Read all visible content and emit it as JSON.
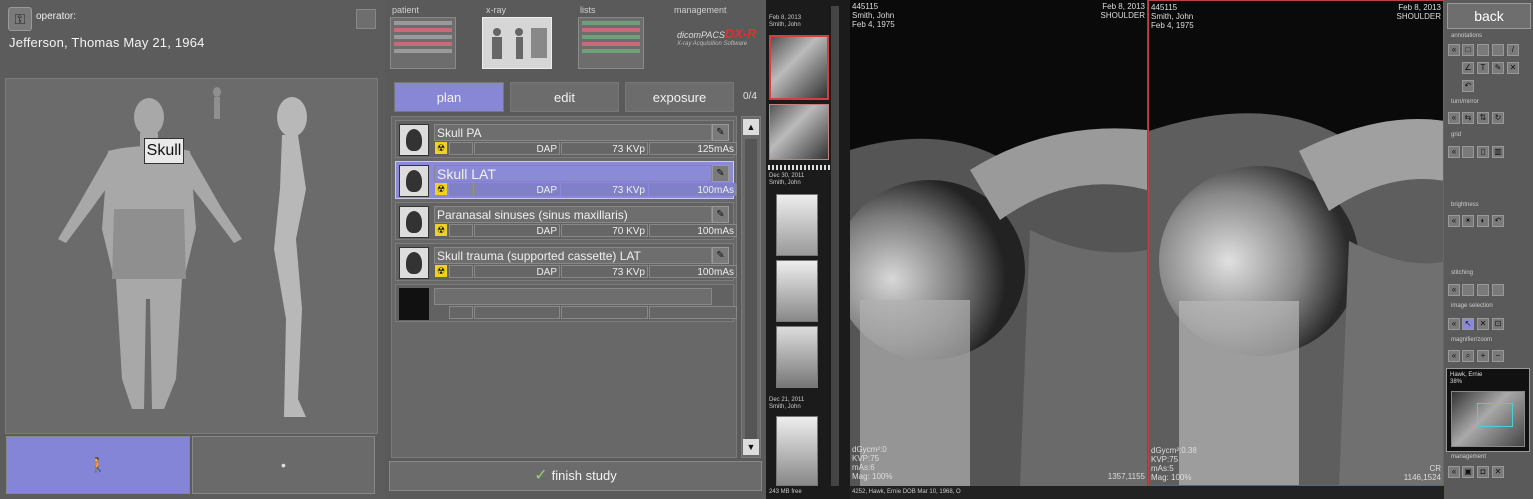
{
  "operator": {
    "label": "operator:",
    "key_icon": "key-icon"
  },
  "patient": {
    "name": "Jefferson,  Thomas  May 21, 1964"
  },
  "body_map": {
    "selected_region": "Skull"
  },
  "header_tabs": [
    {
      "label": "patient"
    },
    {
      "label": "x-ray"
    },
    {
      "label": "lists"
    },
    {
      "label": "management"
    }
  ],
  "brand": {
    "prefix": "dicomPACS",
    "suffix": "DX-R",
    "tagline": "X-ray Acquisition Software"
  },
  "mode_tabs": {
    "plan": "plan",
    "edit": "edit",
    "exposure": "exposure"
  },
  "exam_count": "0/4",
  "exams": [
    {
      "name": "Skull PA",
      "dap": "DAP",
      "kvp": "73 KVp",
      "mas": "125mAs",
      "selected": false
    },
    {
      "name": "Skull LAT",
      "dap": "DAP",
      "kvp": "73 KVp",
      "mas": "100mAs",
      "selected": true
    },
    {
      "name": "Paranasal sinuses (sinus maxillaris)",
      "dap": "DAP",
      "kvp": "70 KVp",
      "mas": "100mAs",
      "selected": false
    },
    {
      "name": "Skull trauma (supported cassette) LAT",
      "dap": "DAP",
      "kvp": "73 KVp",
      "mas": "100mAs",
      "selected": false
    }
  ],
  "finish_label": "finish study",
  "strip": {
    "s1_date": "Feb 8, 2013",
    "s1_name": "Smith, John",
    "s2_date": "Dec 30, 2011",
    "s2_name": "Smith, John",
    "s3_date": "Dec 21, 2011",
    "s3_name": "Smith, John",
    "footer": "243 MB free"
  },
  "viewer1": {
    "id": "445115",
    "name": "Smith, John",
    "dob": "Feb 4, 1975",
    "date": "Feb 8, 2013",
    "region": "SHOULDER",
    "dgy": "dGycm²:0",
    "kvp": "KVP:75",
    "mas": "mAs:6",
    "mag": "Mag: 100%",
    "size": "1357,1155"
  },
  "viewer2": {
    "id": "445115",
    "name": "Smith, John",
    "dob": "Feb 4, 1975",
    "date": "Feb 8, 2013",
    "region": "SHOULDER",
    "dgy": "dGycm²:0.38",
    "kvp": "KVP:75",
    "mas": "mAs:5",
    "mag": "Mag: 100%",
    "cr": "CR",
    "size": "1146,1524"
  },
  "bottom_bar": "4252, Hawk, Ernie DOB Mar 10, 1968, O",
  "tools": {
    "back": "back",
    "annotations": "annotations",
    "turn_mirror": "turn/mirror",
    "grid": "grid",
    "brightness": "brightness",
    "stitching": "stitching",
    "image_selection": "image selection",
    "magnifier": "magnifier/zoom",
    "minimap_name": "Hawk, Ernie",
    "minimap_zoom": "38%",
    "management": "management"
  },
  "colors": {
    "accent": "#8787d6",
    "panel": "#5a5a5a",
    "radiation": "#f0d020"
  }
}
